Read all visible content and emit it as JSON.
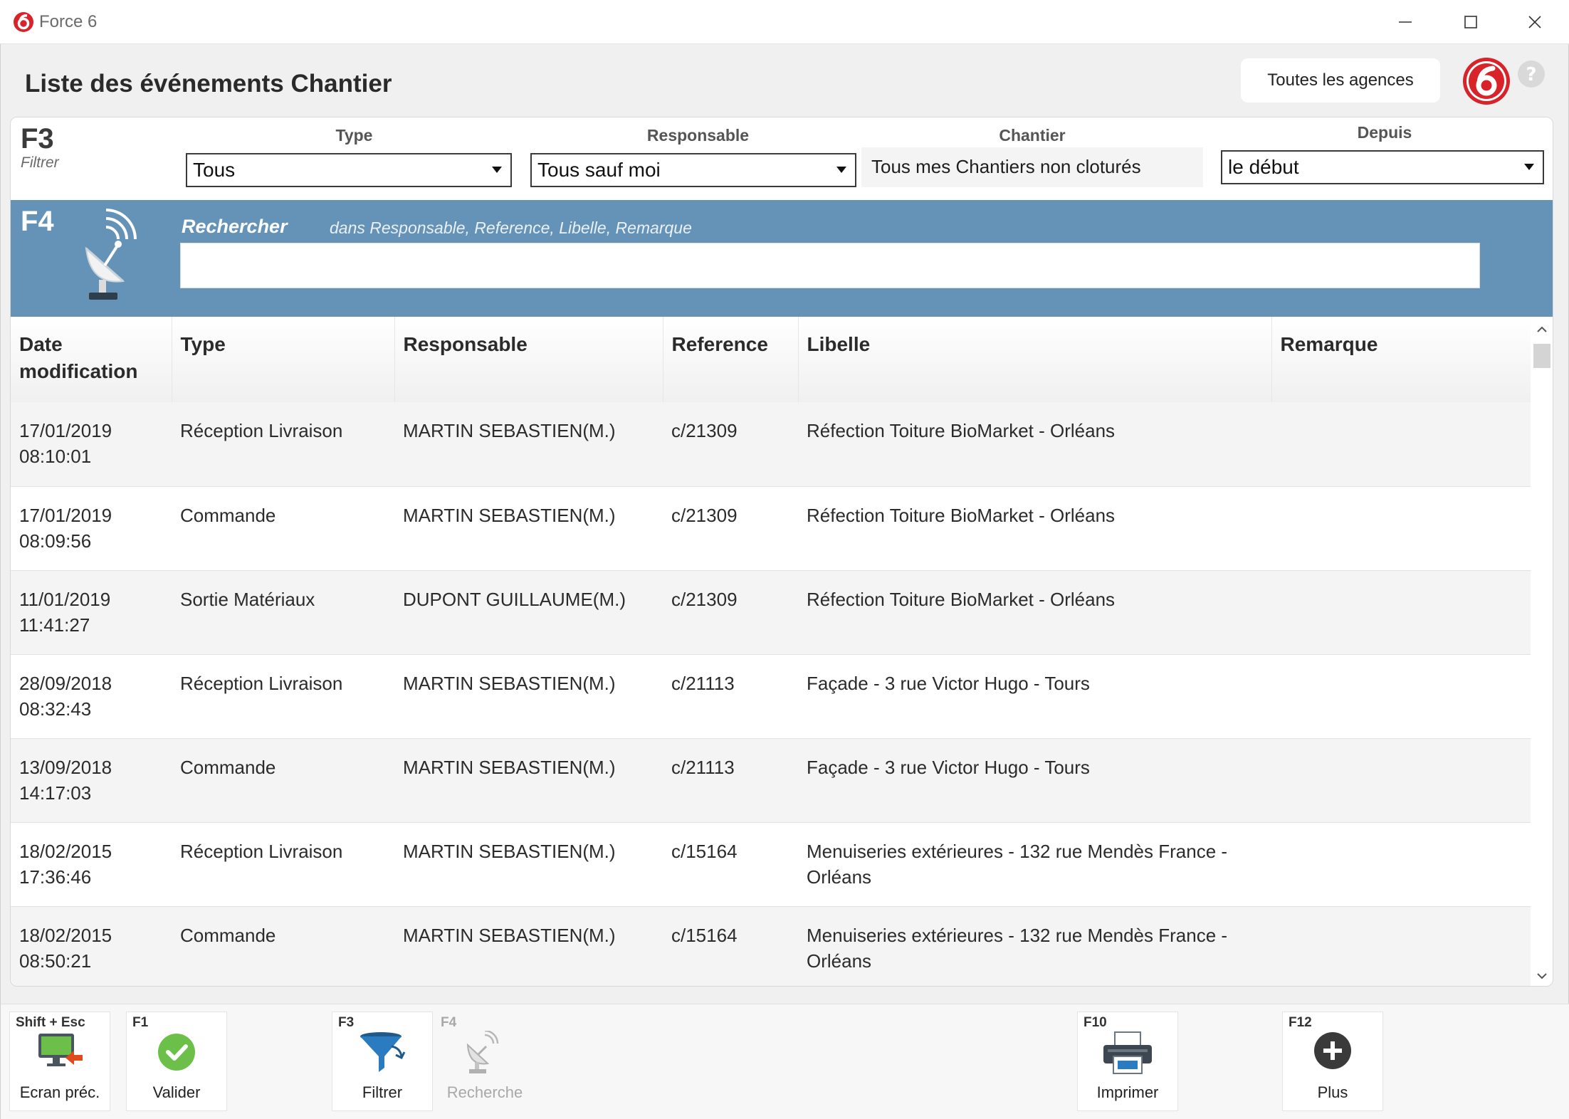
{
  "window": {
    "title": "Force 6",
    "minimize_icon": "minimize-icon",
    "maximize_icon": "maximize-icon",
    "close_icon": "close-icon"
  },
  "header": {
    "page_title": "Liste des événements Chantier",
    "agencies_button": "Toutes les agences",
    "logo_icon": "force6-logo",
    "help_icon": "help-icon",
    "brand_color": "#d8232a"
  },
  "filter": {
    "key": "F3",
    "key_label": "Filtrer",
    "type_label": "Type",
    "type_value": "Tous",
    "responsable_label": "Responsable",
    "responsable_value": "Tous sauf moi",
    "chantier_label": "Chantier",
    "chantier_value": "Tous mes Chantiers non cloturés",
    "depuis_label": "Depuis",
    "depuis_value": "le début"
  },
  "search": {
    "key": "F4",
    "label": "Rechercher",
    "hint": "dans Responsable, Reference, Libelle, Remarque",
    "value": "",
    "icon": "satellite-dish-icon",
    "band_color": "#6593b8"
  },
  "table": {
    "headers": {
      "date": "Date modification",
      "type": "Type",
      "responsable": "Responsable",
      "reference": "Reference",
      "libelle": "Libelle",
      "remarque": "Remarque"
    },
    "rows": [
      {
        "date": "17/01/2019",
        "time": "08:10:01",
        "type": "Réception Livraison",
        "responsable": "MARTIN SEBASTIEN(M.)",
        "reference": "c/21309",
        "libelle": "Réfection Toiture BioMarket - Orléans",
        "remarque": ""
      },
      {
        "date": "17/01/2019",
        "time": "08:09:56",
        "type": "Commande",
        "responsable": "MARTIN SEBASTIEN(M.)",
        "reference": "c/21309",
        "libelle": "Réfection Toiture BioMarket - Orléans",
        "remarque": ""
      },
      {
        "date": "11/01/2019",
        "time": "11:41:27",
        "type": "Sortie Matériaux",
        "responsable": "DUPONT GUILLAUME(M.)",
        "reference": "c/21309",
        "libelle": "Réfection Toiture BioMarket - Orléans",
        "remarque": ""
      },
      {
        "date": "28/09/2018",
        "time": "08:32:43",
        "type": "Réception Livraison",
        "responsable": "MARTIN SEBASTIEN(M.)",
        "reference": "c/21113",
        "libelle": "Façade - 3 rue Victor Hugo - Tours",
        "remarque": ""
      },
      {
        "date": "13/09/2018",
        "time": "14:17:03",
        "type": "Commande",
        "responsable": "MARTIN SEBASTIEN(M.)",
        "reference": "c/21113",
        "libelle": "Façade - 3 rue Victor Hugo - Tours",
        "remarque": ""
      },
      {
        "date": "18/02/2015",
        "time": "17:36:46",
        "type": "Réception Livraison",
        "responsable": "MARTIN SEBASTIEN(M.)",
        "reference": "c/15164",
        "libelle": "Menuiseries extérieures - 132 rue Mendès France - Orléans",
        "remarque": ""
      },
      {
        "date": "18/02/2015",
        "time": "08:50:21",
        "type": "Commande",
        "responsable": "MARTIN SEBASTIEN(M.)",
        "reference": "c/15164",
        "libelle": "Menuiseries extérieures - 132 rue Mendès France - Orléans",
        "remarque": ""
      }
    ]
  },
  "toolbar": {
    "buttons": [
      {
        "key": "Shift + Esc",
        "label": "Ecran préc.",
        "icon": "previous-screen-icon",
        "enabled": true
      },
      {
        "key": "F1",
        "label": "Valider",
        "icon": "check-icon",
        "enabled": true
      },
      {
        "key": "F3",
        "label": "Filtrer",
        "icon": "funnel-icon",
        "enabled": true
      },
      {
        "key": "F4",
        "label": "Recherche",
        "icon": "satellite-dish-icon",
        "enabled": false
      },
      {
        "key": "F10",
        "label": "Imprimer",
        "icon": "printer-icon",
        "enabled": true
      },
      {
        "key": "F12",
        "label": "Plus",
        "icon": "plus-icon",
        "enabled": true
      }
    ]
  }
}
